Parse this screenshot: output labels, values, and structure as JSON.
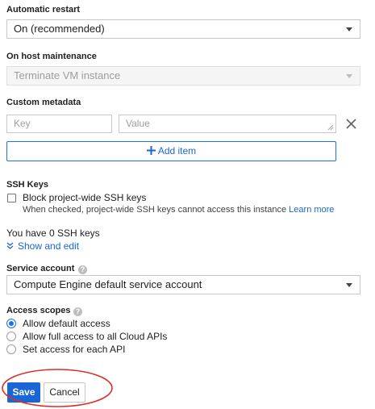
{
  "automatic_restart": {
    "label": "Automatic restart",
    "value": "On (recommended)"
  },
  "on_host_maintenance": {
    "label": "On host maintenance",
    "value": "Terminate VM instance"
  },
  "custom_metadata": {
    "label": "Custom metadata",
    "key_placeholder": "Key",
    "value_placeholder": "Value",
    "add_item_label": "Add item"
  },
  "ssh_keys": {
    "label": "SSH Keys",
    "block_label": "Block project-wide SSH keys",
    "help_text": "When checked, project-wide SSH keys cannot access this instance",
    "learn_more": "Learn more",
    "count_text": "You have 0 SSH keys",
    "show_edit": "Show and edit"
  },
  "service_account": {
    "label": "Service account",
    "value": "Compute Engine default service account"
  },
  "access_scopes": {
    "label": "Access scopes",
    "options": [
      "Allow default access",
      "Allow full access to all Cloud APIs",
      "Set access for each API"
    ],
    "selected": 0
  },
  "actions": {
    "save": "Save",
    "cancel": "Cancel"
  },
  "colors": {
    "accent": "#1a73e8",
    "annotation": "#d93025"
  }
}
